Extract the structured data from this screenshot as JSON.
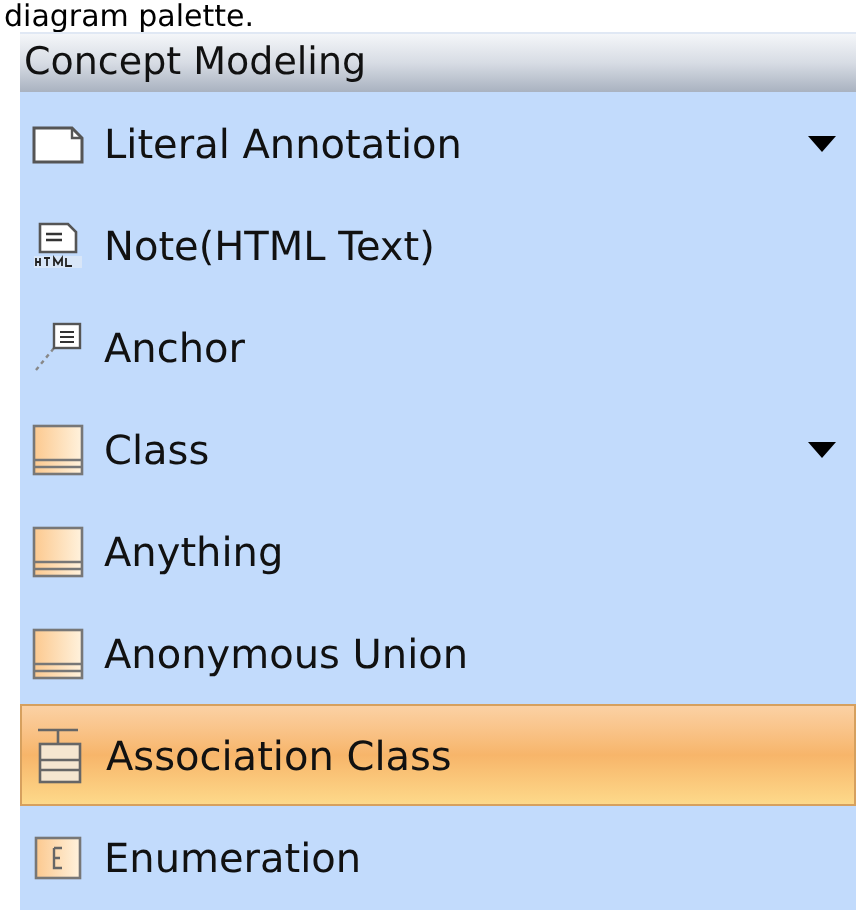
{
  "caption": "diagram palette.",
  "palette": {
    "title": "Concept Modeling",
    "items": [
      {
        "label": "Literal Annotation",
        "kind": "note",
        "has_menu": true,
        "selected": false
      },
      {
        "label": "Note(HTML Text)",
        "kind": "html-note",
        "has_menu": false,
        "selected": false
      },
      {
        "label": "Anchor",
        "kind": "anchor",
        "has_menu": false,
        "selected": false
      },
      {
        "label": "Class",
        "kind": "class",
        "has_menu": true,
        "selected": false
      },
      {
        "label": "Anything",
        "kind": "class",
        "has_menu": false,
        "selected": false
      },
      {
        "label": "Anonymous Union",
        "kind": "class",
        "has_menu": false,
        "selected": false
      },
      {
        "label": "Association Class",
        "kind": "association-class",
        "has_menu": false,
        "selected": true
      },
      {
        "label": "Enumeration",
        "kind": "enumeration",
        "has_menu": false,
        "selected": false
      }
    ]
  }
}
